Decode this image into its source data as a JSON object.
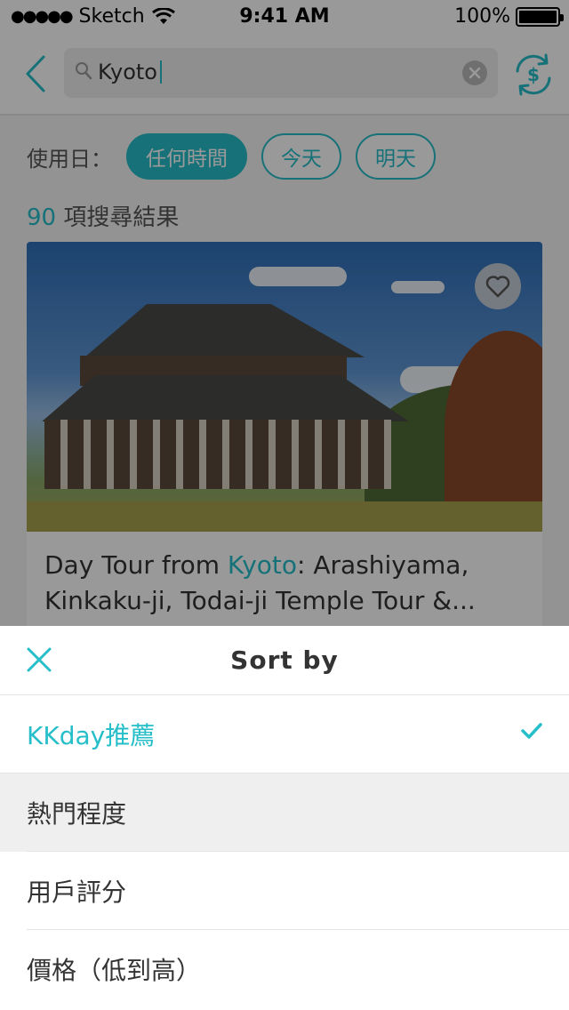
{
  "status_bar": {
    "carrier": "Sketch",
    "time": "9:41 AM",
    "battery": "100%"
  },
  "search": {
    "value": "Kyoto"
  },
  "filters": {
    "label": "使用日：",
    "chips": [
      {
        "label": "任何時間",
        "active": true
      },
      {
        "label": "今天",
        "active": false
      },
      {
        "label": "明天",
        "active": false
      }
    ]
  },
  "results": {
    "count": "90",
    "label": "項搜尋結果"
  },
  "card": {
    "title_prefix": "Day Tour from ",
    "title_highlight": "Kyoto",
    "title_suffix": ": Arashiyama, Kinkaku-ji, Todai-ji Temple Tour &..."
  },
  "sort_sheet": {
    "title": "Sort by",
    "options": [
      {
        "label": "KKday推薦",
        "selected": true
      },
      {
        "label": "熱門程度",
        "selected": false
      },
      {
        "label": "用戶評分",
        "selected": false
      },
      {
        "label": "價格（低到高）",
        "selected": false
      }
    ]
  },
  "colors": {
    "accent": "#26bec9",
    "overlay": "rgba(0,0,0,0.4)"
  },
  "icons": {
    "back": "chevron-left-icon",
    "search": "search-icon",
    "clear": "clear-icon",
    "currency": "currency-exchange-icon",
    "favorite": "heart-icon",
    "close": "close-icon",
    "check": "check-icon"
  }
}
